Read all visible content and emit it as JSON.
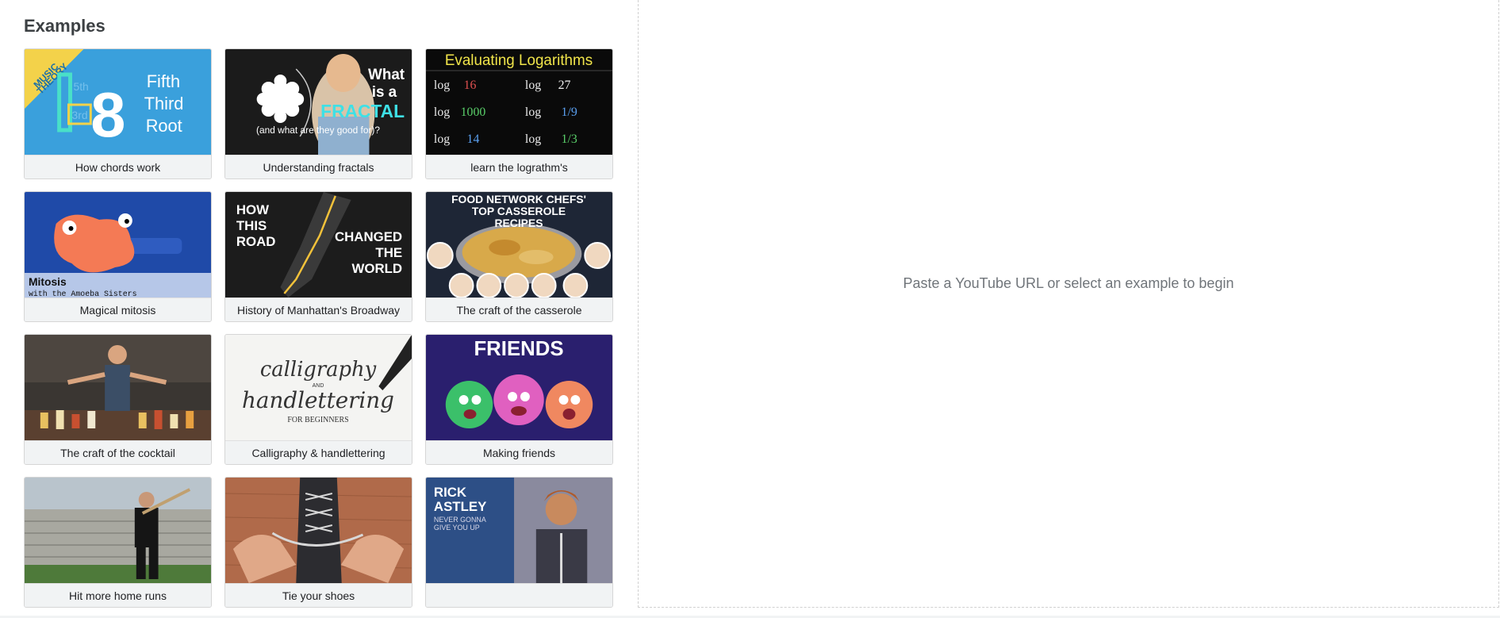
{
  "examples": {
    "title": "Examples",
    "items": [
      {
        "caption": "How chords work",
        "thumb_text": [
          "MUSIC",
          "THEORY",
          "5th",
          "3rd",
          "8",
          "Fifth",
          "Third",
          "Root"
        ]
      },
      {
        "caption": "Understanding fractals",
        "thumb_text": [
          "What",
          "is a",
          "FRACTAL",
          "(and what are they good for)?"
        ]
      },
      {
        "caption": "learn the lograthm's",
        "thumb_text": [
          "Evaluating Logarithms",
          "log",
          "16",
          "1000",
          "14",
          "27",
          "1/9",
          "1/3"
        ]
      },
      {
        "caption": "Magical mitosis",
        "thumb_text": [
          "Mitosis",
          "with the Amoeba Sisters"
        ]
      },
      {
        "caption": "History of Manhattan's Broadway",
        "thumb_text": [
          "HOW",
          "THIS",
          "ROAD",
          "CHANGED",
          "THE",
          "WORLD"
        ]
      },
      {
        "caption": "The craft of the casserole",
        "thumb_text": [
          "FOOD NETWORK CHEFS'",
          "TOP CASSEROLE",
          "RECIPES"
        ]
      },
      {
        "caption": "The craft of the cocktail",
        "thumb_text": []
      },
      {
        "caption": "Calligraphy & handlettering",
        "thumb_text": [
          "calligraphy",
          "AND",
          "handlettering",
          "FOR BEGINNERS"
        ]
      },
      {
        "caption": "Making friends",
        "thumb_text": [
          "FRIENDS"
        ]
      },
      {
        "caption": "Hit more home runs",
        "thumb_text": []
      },
      {
        "caption": "Tie your shoes",
        "thumb_text": []
      },
      {
        "caption": "",
        "thumb_text": [
          "RICK",
          "ASTLEY",
          "NEVER GONNA",
          "GIVE YOU UP"
        ]
      }
    ]
  },
  "viewer": {
    "prompt": "Paste a YouTube URL or select an example to begin"
  },
  "colors": {
    "card_bg": "#f1f3f4",
    "border": "#d6d6d6",
    "prompt_text": "#70757a"
  }
}
